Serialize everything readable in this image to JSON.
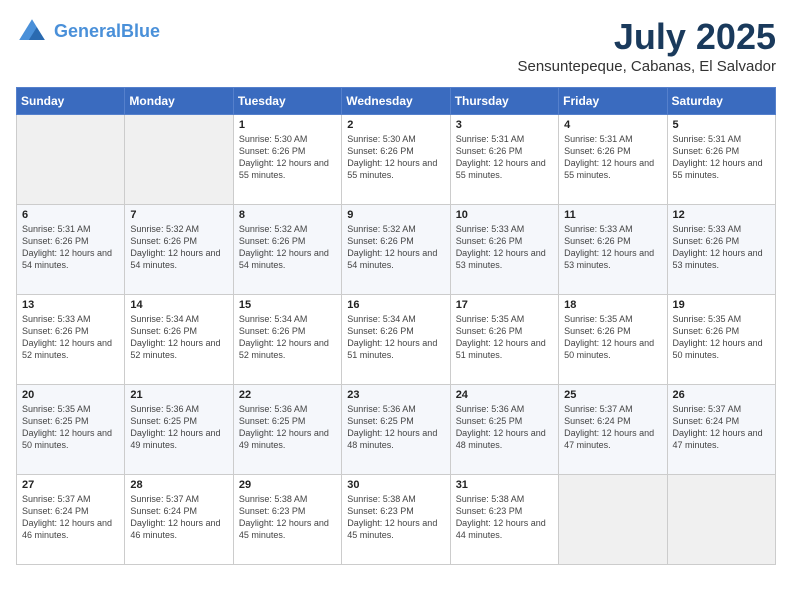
{
  "header": {
    "logo_line1": "General",
    "logo_line2": "Blue",
    "title": "July 2025",
    "subtitle": "Sensuntepeque, Cabanas, El Salvador"
  },
  "weekdays": [
    "Sunday",
    "Monday",
    "Tuesday",
    "Wednesday",
    "Thursday",
    "Friday",
    "Saturday"
  ],
  "weeks": [
    [
      {
        "day": "",
        "sunrise": "",
        "sunset": "",
        "daylight": ""
      },
      {
        "day": "",
        "sunrise": "",
        "sunset": "",
        "daylight": ""
      },
      {
        "day": "1",
        "sunrise": "Sunrise: 5:30 AM",
        "sunset": "Sunset: 6:26 PM",
        "daylight": "Daylight: 12 hours and 55 minutes."
      },
      {
        "day": "2",
        "sunrise": "Sunrise: 5:30 AM",
        "sunset": "Sunset: 6:26 PM",
        "daylight": "Daylight: 12 hours and 55 minutes."
      },
      {
        "day": "3",
        "sunrise": "Sunrise: 5:31 AM",
        "sunset": "Sunset: 6:26 PM",
        "daylight": "Daylight: 12 hours and 55 minutes."
      },
      {
        "day": "4",
        "sunrise": "Sunrise: 5:31 AM",
        "sunset": "Sunset: 6:26 PM",
        "daylight": "Daylight: 12 hours and 55 minutes."
      },
      {
        "day": "5",
        "sunrise": "Sunrise: 5:31 AM",
        "sunset": "Sunset: 6:26 PM",
        "daylight": "Daylight: 12 hours and 55 minutes."
      }
    ],
    [
      {
        "day": "6",
        "sunrise": "Sunrise: 5:31 AM",
        "sunset": "Sunset: 6:26 PM",
        "daylight": "Daylight: 12 hours and 54 minutes."
      },
      {
        "day": "7",
        "sunrise": "Sunrise: 5:32 AM",
        "sunset": "Sunset: 6:26 PM",
        "daylight": "Daylight: 12 hours and 54 minutes."
      },
      {
        "day": "8",
        "sunrise": "Sunrise: 5:32 AM",
        "sunset": "Sunset: 6:26 PM",
        "daylight": "Daylight: 12 hours and 54 minutes."
      },
      {
        "day": "9",
        "sunrise": "Sunrise: 5:32 AM",
        "sunset": "Sunset: 6:26 PM",
        "daylight": "Daylight: 12 hours and 54 minutes."
      },
      {
        "day": "10",
        "sunrise": "Sunrise: 5:33 AM",
        "sunset": "Sunset: 6:26 PM",
        "daylight": "Daylight: 12 hours and 53 minutes."
      },
      {
        "day": "11",
        "sunrise": "Sunrise: 5:33 AM",
        "sunset": "Sunset: 6:26 PM",
        "daylight": "Daylight: 12 hours and 53 minutes."
      },
      {
        "day": "12",
        "sunrise": "Sunrise: 5:33 AM",
        "sunset": "Sunset: 6:26 PM",
        "daylight": "Daylight: 12 hours and 53 minutes."
      }
    ],
    [
      {
        "day": "13",
        "sunrise": "Sunrise: 5:33 AM",
        "sunset": "Sunset: 6:26 PM",
        "daylight": "Daylight: 12 hours and 52 minutes."
      },
      {
        "day": "14",
        "sunrise": "Sunrise: 5:34 AM",
        "sunset": "Sunset: 6:26 PM",
        "daylight": "Daylight: 12 hours and 52 minutes."
      },
      {
        "day": "15",
        "sunrise": "Sunrise: 5:34 AM",
        "sunset": "Sunset: 6:26 PM",
        "daylight": "Daylight: 12 hours and 52 minutes."
      },
      {
        "day": "16",
        "sunrise": "Sunrise: 5:34 AM",
        "sunset": "Sunset: 6:26 PM",
        "daylight": "Daylight: 12 hours and 51 minutes."
      },
      {
        "day": "17",
        "sunrise": "Sunrise: 5:35 AM",
        "sunset": "Sunset: 6:26 PM",
        "daylight": "Daylight: 12 hours and 51 minutes."
      },
      {
        "day": "18",
        "sunrise": "Sunrise: 5:35 AM",
        "sunset": "Sunset: 6:26 PM",
        "daylight": "Daylight: 12 hours and 50 minutes."
      },
      {
        "day": "19",
        "sunrise": "Sunrise: 5:35 AM",
        "sunset": "Sunset: 6:26 PM",
        "daylight": "Daylight: 12 hours and 50 minutes."
      }
    ],
    [
      {
        "day": "20",
        "sunrise": "Sunrise: 5:35 AM",
        "sunset": "Sunset: 6:25 PM",
        "daylight": "Daylight: 12 hours and 50 minutes."
      },
      {
        "day": "21",
        "sunrise": "Sunrise: 5:36 AM",
        "sunset": "Sunset: 6:25 PM",
        "daylight": "Daylight: 12 hours and 49 minutes."
      },
      {
        "day": "22",
        "sunrise": "Sunrise: 5:36 AM",
        "sunset": "Sunset: 6:25 PM",
        "daylight": "Daylight: 12 hours and 49 minutes."
      },
      {
        "day": "23",
        "sunrise": "Sunrise: 5:36 AM",
        "sunset": "Sunset: 6:25 PM",
        "daylight": "Daylight: 12 hours and 48 minutes."
      },
      {
        "day": "24",
        "sunrise": "Sunrise: 5:36 AM",
        "sunset": "Sunset: 6:25 PM",
        "daylight": "Daylight: 12 hours and 48 minutes."
      },
      {
        "day": "25",
        "sunrise": "Sunrise: 5:37 AM",
        "sunset": "Sunset: 6:24 PM",
        "daylight": "Daylight: 12 hours and 47 minutes."
      },
      {
        "day": "26",
        "sunrise": "Sunrise: 5:37 AM",
        "sunset": "Sunset: 6:24 PM",
        "daylight": "Daylight: 12 hours and 47 minutes."
      }
    ],
    [
      {
        "day": "27",
        "sunrise": "Sunrise: 5:37 AM",
        "sunset": "Sunset: 6:24 PM",
        "daylight": "Daylight: 12 hours and 46 minutes."
      },
      {
        "day": "28",
        "sunrise": "Sunrise: 5:37 AM",
        "sunset": "Sunset: 6:24 PM",
        "daylight": "Daylight: 12 hours and 46 minutes."
      },
      {
        "day": "29",
        "sunrise": "Sunrise: 5:38 AM",
        "sunset": "Sunset: 6:23 PM",
        "daylight": "Daylight: 12 hours and 45 minutes."
      },
      {
        "day": "30",
        "sunrise": "Sunrise: 5:38 AM",
        "sunset": "Sunset: 6:23 PM",
        "daylight": "Daylight: 12 hours and 45 minutes."
      },
      {
        "day": "31",
        "sunrise": "Sunrise: 5:38 AM",
        "sunset": "Sunset: 6:23 PM",
        "daylight": "Daylight: 12 hours and 44 minutes."
      },
      {
        "day": "",
        "sunrise": "",
        "sunset": "",
        "daylight": ""
      },
      {
        "day": "",
        "sunrise": "",
        "sunset": "",
        "daylight": ""
      }
    ]
  ]
}
